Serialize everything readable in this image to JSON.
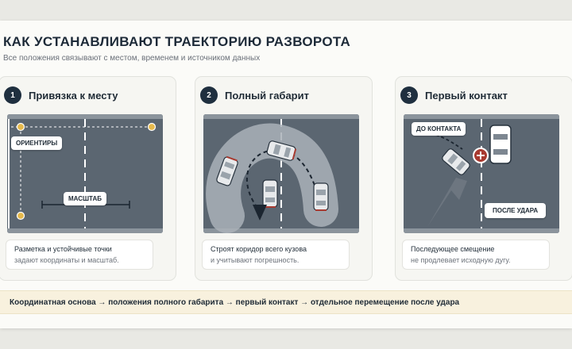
{
  "header": {
    "title": "КАК УСТАНАВЛИВАЮТ ТРАЕКТОРИЮ РАЗВОРОТА",
    "subtitle": "Все положения связывают с местом, временем и источником данных"
  },
  "steps": [
    {
      "number": "1",
      "title": "Привязка к месту",
      "labels": [
        "ОРИЕНТИРЫ",
        "МАСШТАБ"
      ],
      "caption_line1": "Разметка и устойчивые точки",
      "caption_line2": "задают координаты и масштаб."
    },
    {
      "number": "2",
      "title": "Полный габарит",
      "caption_line1": "Строят коридор всего кузова",
      "caption_line2": "и учитывают погрешность."
    },
    {
      "number": "3",
      "title": "Первый контакт",
      "labels": [
        "ДО КОНТАКТА",
        "ПОСЛЕ УДАРА"
      ],
      "caption_line1": "Последующее смещение",
      "caption_line2": "не продлевает исходную дугу."
    }
  ],
  "footer": {
    "summary": "Координатная основа → положения полного габарита → первый контакт → отдельное перемещение после удара"
  },
  "colors": {
    "road": "#5b6671",
    "corridor": "#aab1b8",
    "landmark": "#e6b94c",
    "contact": "#a83a30",
    "banner": "#f8f1de",
    "badge": "#1f2f3f"
  }
}
